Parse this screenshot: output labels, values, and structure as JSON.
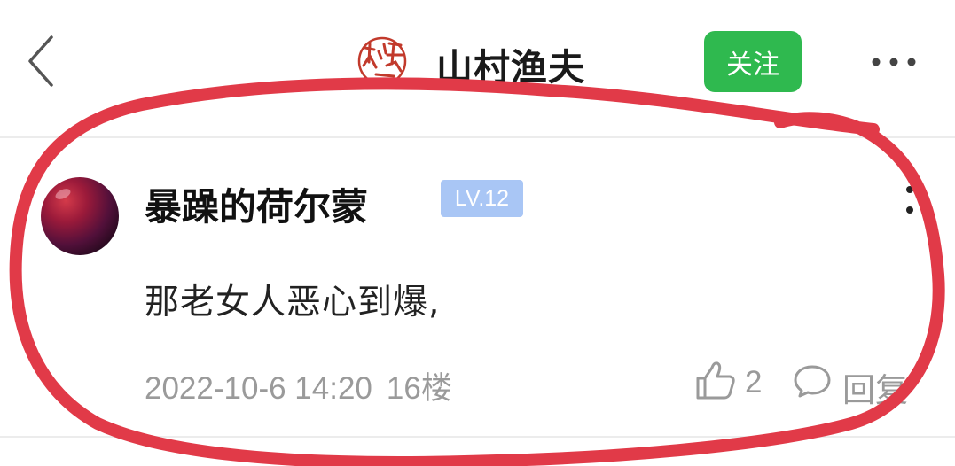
{
  "header": {
    "title": "山村渔夫",
    "follow_label": "关注",
    "seal_text": "大渔"
  },
  "comment": {
    "username": "暴躁的荷尔蒙",
    "level": "LV.12",
    "text": "那老女人恶心到爆,",
    "timestamp": "2022-10-6 14:20",
    "floor": "16楼",
    "likes": "2",
    "reply_label": "回复"
  },
  "icons": [
    "back-icon",
    "seal-logo",
    "more-icon",
    "avatar",
    "comment-more-icon",
    "like-icon",
    "reply-icon"
  ],
  "colors": {
    "follow_button": "#2fb94f",
    "level_badge": "#a9c6f5",
    "seal_red": "#c23a2c",
    "annotation_red": "#e13a48",
    "meta_text": "#9a9a9a"
  }
}
